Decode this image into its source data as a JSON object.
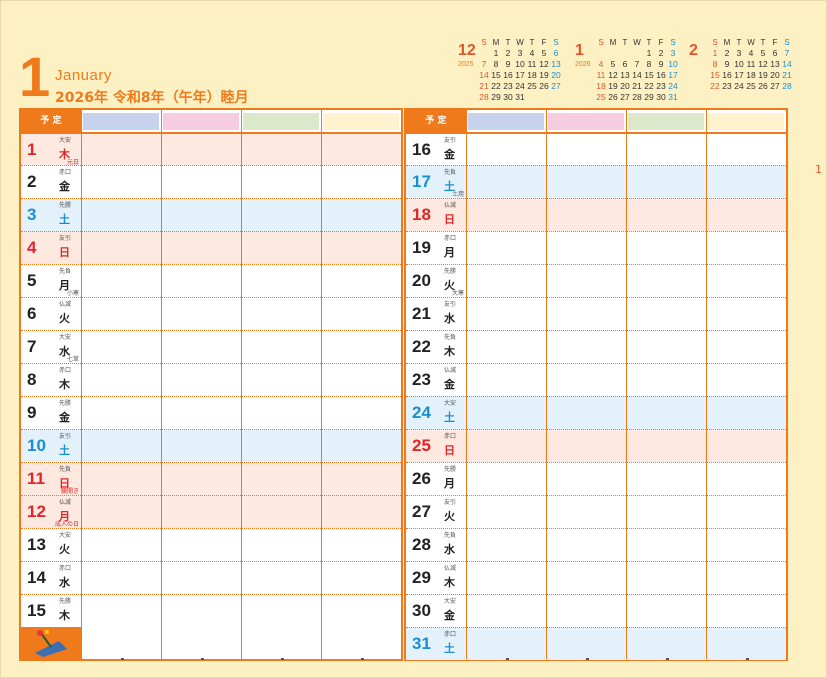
{
  "month": {
    "number": "1",
    "name_en": "January",
    "title_jp": "2026年 令和8年（午年）睦月"
  },
  "page_number": "1",
  "header": {
    "yotei": "予 定",
    "colors": [
      "#c7d3ec",
      "#f6cde0",
      "#dbe8c9",
      "#fff3cf"
    ]
  },
  "mini_calendars": [
    {
      "month": "12",
      "year": "2025",
      "weekdays": [
        "S",
        "M",
        "T",
        "W",
        "T",
        "F",
        "S"
      ],
      "weeks": [
        [
          "",
          "1",
          "2",
          "3",
          "4",
          "5",
          "6"
        ],
        [
          "7",
          "8",
          "9",
          "10",
          "11",
          "12",
          "13"
        ],
        [
          "14",
          "15",
          "16",
          "17",
          "18",
          "19",
          "20"
        ],
        [
          "21",
          "22",
          "23",
          "24",
          "25",
          "26",
          "27"
        ],
        [
          "28",
          "29",
          "30",
          "31",
          "",
          "",
          ""
        ]
      ]
    },
    {
      "month": "1",
      "year": "2026",
      "weekdays": [
        "S",
        "M",
        "T",
        "W",
        "T",
        "F",
        "S"
      ],
      "weeks": [
        [
          "",
          "",
          "",
          "",
          "1",
          "2",
          "3"
        ],
        [
          "4",
          "5",
          "6",
          "7",
          "8",
          "9",
          "10"
        ],
        [
          "11",
          "12",
          "13",
          "14",
          "15",
          "16",
          "17"
        ],
        [
          "18",
          "19",
          "20",
          "21",
          "22",
          "23",
          "24"
        ],
        [
          "25",
          "26",
          "27",
          "28",
          "29",
          "30",
          "31"
        ]
      ]
    },
    {
      "month": "2",
      "year": "",
      "weekdays": [
        "S",
        "M",
        "T",
        "W",
        "T",
        "F",
        "S"
      ],
      "weeks": [
        [
          "1",
          "2",
          "3",
          "4",
          "5",
          "6",
          "7"
        ],
        [
          "8",
          "9",
          "10",
          "11",
          "12",
          "13",
          "14"
        ],
        [
          "15",
          "16",
          "17",
          "18",
          "19",
          "20",
          "21"
        ],
        [
          "22",
          "23",
          "24",
          "25",
          "26",
          "27",
          "28"
        ]
      ]
    }
  ],
  "left_days": [
    {
      "day": "1",
      "dow": "木",
      "rokuyo": "大安",
      "holiday": "元日",
      "kind": "sun"
    },
    {
      "day": "2",
      "dow": "金",
      "rokuyo": "赤口",
      "holiday": "",
      "kind": ""
    },
    {
      "day": "3",
      "dow": "土",
      "rokuyo": "先勝",
      "holiday": "",
      "kind": "sat"
    },
    {
      "day": "4",
      "dow": "日",
      "rokuyo": "友引",
      "holiday": "",
      "kind": "sun"
    },
    {
      "day": "5",
      "dow": "月",
      "rokuyo": "先負",
      "holiday": "小寒",
      "kind": ""
    },
    {
      "day": "6",
      "dow": "火",
      "rokuyo": "仏滅",
      "holiday": "",
      "kind": ""
    },
    {
      "day": "7",
      "dow": "水",
      "rokuyo": "大安",
      "holiday": "七草",
      "kind": ""
    },
    {
      "day": "8",
      "dow": "木",
      "rokuyo": "赤口",
      "holiday": "",
      "kind": ""
    },
    {
      "day": "9",
      "dow": "金",
      "rokuyo": "先勝",
      "holiday": "",
      "kind": ""
    },
    {
      "day": "10",
      "dow": "土",
      "rokuyo": "友引",
      "holiday": "",
      "kind": "sat"
    },
    {
      "day": "11",
      "dow": "日",
      "rokuyo": "先負",
      "holiday": "鏡開き",
      "kind": "sun"
    },
    {
      "day": "12",
      "dow": "月",
      "rokuyo": "仏滅",
      "holiday": "成人の日",
      "kind": "sun"
    },
    {
      "day": "13",
      "dow": "火",
      "rokuyo": "大安",
      "holiday": "",
      "kind": ""
    },
    {
      "day": "14",
      "dow": "水",
      "rokuyo": "赤口",
      "holiday": "",
      "kind": ""
    },
    {
      "day": "15",
      "dow": "木",
      "rokuyo": "先勝",
      "holiday": "",
      "kind": ""
    }
  ],
  "right_days": [
    {
      "day": "16",
      "dow": "金",
      "rokuyo": "友引",
      "holiday": "",
      "kind": ""
    },
    {
      "day": "17",
      "dow": "土",
      "rokuyo": "先負",
      "holiday": "土用",
      "kind": "sat"
    },
    {
      "day": "18",
      "dow": "日",
      "rokuyo": "仏滅",
      "holiday": "",
      "kind": "sun"
    },
    {
      "day": "19",
      "dow": "月",
      "rokuyo": "赤口",
      "holiday": "",
      "kind": ""
    },
    {
      "day": "20",
      "dow": "火",
      "rokuyo": "先勝",
      "holiday": "大寒",
      "kind": ""
    },
    {
      "day": "21",
      "dow": "水",
      "rokuyo": "友引",
      "holiday": "",
      "kind": ""
    },
    {
      "day": "22",
      "dow": "木",
      "rokuyo": "先負",
      "holiday": "",
      "kind": ""
    },
    {
      "day": "23",
      "dow": "金",
      "rokuyo": "仏滅",
      "holiday": "",
      "kind": ""
    },
    {
      "day": "24",
      "dow": "土",
      "rokuyo": "大安",
      "holiday": "",
      "kind": "sat"
    },
    {
      "day": "25",
      "dow": "日",
      "rokuyo": "赤口",
      "holiday": "",
      "kind": "sun"
    },
    {
      "day": "26",
      "dow": "月",
      "rokuyo": "先勝",
      "holiday": "",
      "kind": ""
    },
    {
      "day": "27",
      "dow": "火",
      "rokuyo": "友引",
      "holiday": "",
      "kind": ""
    },
    {
      "day": "28",
      "dow": "水",
      "rokuyo": "先負",
      "holiday": "",
      "kind": ""
    },
    {
      "day": "29",
      "dow": "木",
      "rokuyo": "仏滅",
      "holiday": "",
      "kind": ""
    },
    {
      "day": "30",
      "dow": "金",
      "rokuyo": "大安",
      "holiday": "",
      "kind": ""
    },
    {
      "day": "31",
      "dow": "土",
      "rokuyo": "赤口",
      "holiday": "",
      "kind": "sat"
    }
  ]
}
